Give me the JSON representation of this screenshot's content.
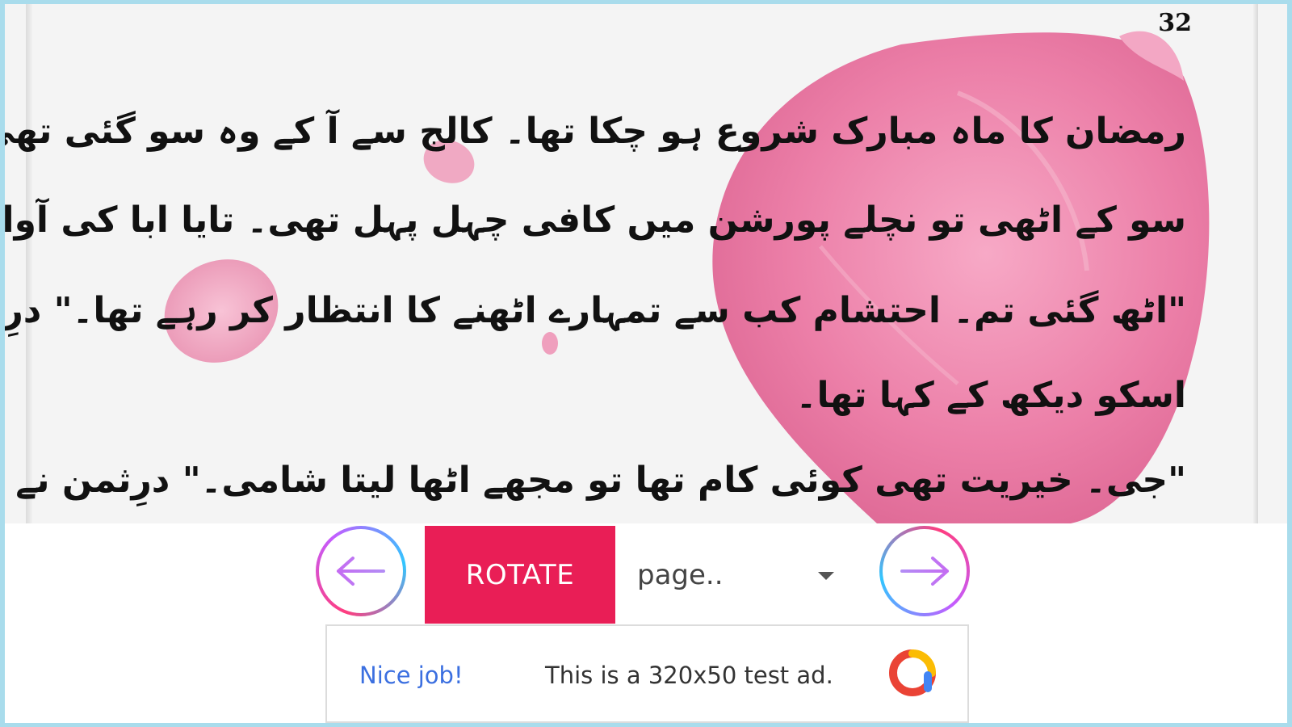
{
  "reader": {
    "page_number": "32",
    "lines": [
      "رمضان کا ماہ مبارک شروع ہو چکا تھا۔ کالج سے آ کے وہ سو گئی تھی۔ عصر کی نماز کے وقت جب وہ",
      "سو کے اٹھی تو نچلے پورشن میں کافی چہل پہل تھی۔ تایا ابا کی آوازیں بھی آ رہی تھی۔",
      "\"اٹھ گئی تم۔ احتشام کب سے تمہارے اٹھنے کا انتظار کر رہے تھا۔\" درِثمن کی امی (فرزانہ) نے",
      "اسکو دیکھ کے کہا تھا۔",
      "\"جی۔ خیریت تھی کوئی کام تھا تو مجھے اٹھا لیتا شامی۔\" درِثمن نے کہا تھا۔"
    ]
  },
  "controls": {
    "prev_icon": "arrow-left-icon",
    "rotate_label": "ROTATE",
    "page_select_value": "page..",
    "next_icon": "arrow-right-icon",
    "accent_color": "#e91e56"
  },
  "ad": {
    "headline": "Nice job!",
    "text": "This is a 320x50 test ad.",
    "logo_icon": "admob-logo-icon"
  }
}
